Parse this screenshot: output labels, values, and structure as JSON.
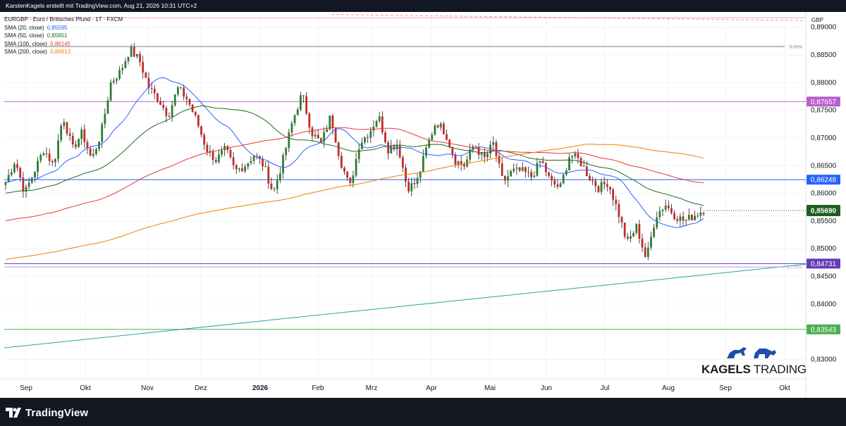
{
  "header": {
    "text": "KarstenKagels erstellt mit TradingView.com, Aug 21, 2026 10:31 UTC+2"
  },
  "footer": {
    "logo_text": "TradingView"
  },
  "legend": {
    "title": "EURGBP · Euro / Britisches Pfund · 1T · FXCM",
    "items": [
      {
        "label": "SMA (20, close)",
        "value": "0,85595",
        "color": "#2962ff"
      },
      {
        "label": "SMA (50, close)",
        "value": "0,85651",
        "color": "#1e6b1e"
      },
      {
        "label": "SMA (100, close)",
        "value": "0,86145",
        "color": "#e53935"
      },
      {
        "label": "SMA (200, close)",
        "value": "0,86613",
        "color": "#f57c00"
      }
    ]
  },
  "watermark": {
    "part1": "KAGELS",
    "part2": " TRADING"
  },
  "chart_data": {
    "type": "candlestick",
    "symbol": "EURGBP",
    "timeframe": "1T",
    "currency_label": "GBP",
    "y_ticks": [
      "0,89000",
      "0,88500",
      "0,88000",
      "0,87500",
      "0,87000",
      "0,86500",
      "0,86000",
      "0,85500",
      "0,85000",
      "0,84500",
      "0,84000",
      "0,83500",
      "0,83000"
    ],
    "y_tick_values": [
      0.89,
      0.885,
      0.88,
      0.875,
      0.87,
      0.865,
      0.86,
      0.855,
      0.85,
      0.845,
      0.84,
      0.835,
      0.83
    ],
    "x_labels": [
      "Sep",
      "Okt",
      "Nov",
      "Dez",
      "2026",
      "Feb",
      "Mrz",
      "Apr",
      "Mai",
      "Jun",
      "Jul",
      "Aug",
      "Sep",
      "Okt"
    ],
    "y_range": [
      0.8265,
      0.8925
    ],
    "price_levels": [
      {
        "value": 0.87657,
        "label": "0,87657",
        "color": "#b660cd"
      },
      {
        "value": 0.86248,
        "label": "0,86248",
        "color": "#2962ff"
      },
      {
        "value": 0.84731,
        "label": "0,84731",
        "color": "#673ab7"
      },
      {
        "value": 0.83543,
        "label": "0,83543",
        "color": "#4caf50"
      }
    ],
    "fib_levels": [
      {
        "label": "0,00%",
        "value": 0.8865
      },
      {
        "label": "61,80%",
        "value": 0.8467
      }
    ],
    "last_price": {
      "value": 0.8569,
      "label": "0,85690",
      "color": "#1e5e20"
    },
    "candle_path": [
      0.862,
      0.866,
      0.86,
      0.864,
      0.868,
      0.865,
      0.874,
      0.868,
      0.871,
      0.866,
      0.871,
      0.88,
      0.882,
      0.886,
      0.884,
      0.879,
      0.877,
      0.874,
      0.879,
      0.877,
      0.873,
      0.868,
      0.866,
      0.868,
      0.864,
      0.865,
      0.867,
      0.865,
      0.86,
      0.866,
      0.873,
      0.878,
      0.871,
      0.869,
      0.874,
      0.866,
      0.861,
      0.869,
      0.871,
      0.874,
      0.868,
      0.869,
      0.861,
      0.862,
      0.868,
      0.873,
      0.871,
      0.866,
      0.865,
      0.869,
      0.866,
      0.869,
      0.862,
      0.864,
      0.864,
      0.863,
      0.866,
      0.862,
      0.861,
      0.867,
      0.866,
      0.863,
      0.861,
      0.862,
      0.857,
      0.851,
      0.854,
      0.848,
      0.856,
      0.858,
      0.856,
      0.855,
      0.856,
      0.857
    ]
  }
}
